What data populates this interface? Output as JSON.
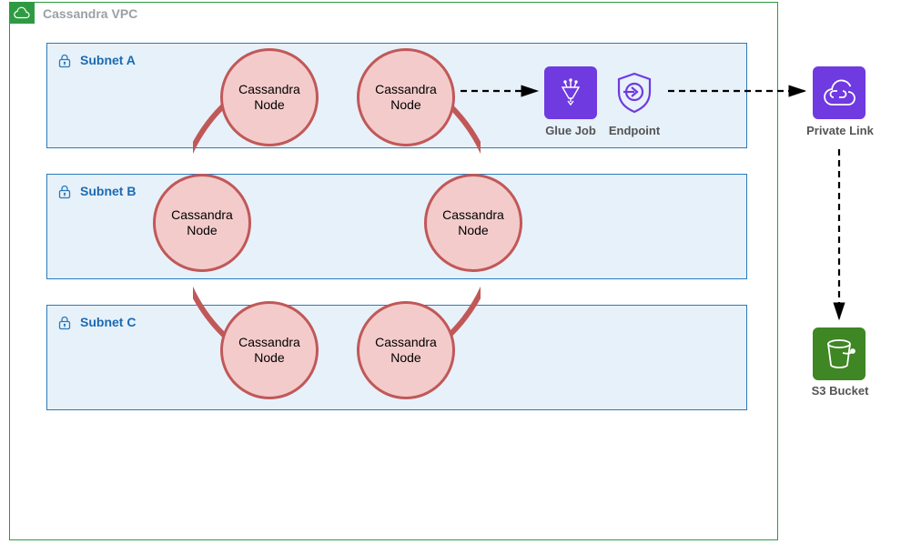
{
  "vpc": {
    "title": "Cassandra VPC",
    "subnets": {
      "a": "Subnet A",
      "b": "Subnet B",
      "c": "Subnet C"
    }
  },
  "nodes": {
    "n1": "Cassandra\nNode",
    "n2": "Cassandra\nNode",
    "n3": "Cassandra\nNode",
    "n4": "Cassandra\nNode",
    "n5": "Cassandra\nNode",
    "n6": "Cassandra\nNode"
  },
  "services": {
    "glue": "Glue Job",
    "endpoint": "Endpoint",
    "privatelink": "Private Link",
    "s3": "S3 Bucket"
  },
  "icons": {
    "vpc_cloud": "vpc-cloud-icon",
    "lock": "lock-icon",
    "glue": "glue-job-icon",
    "endpoint": "endpoint-icon",
    "privatelink": "private-link-icon",
    "s3": "s3-bucket-icon"
  },
  "colors": {
    "vpc_green": "#2e9b42",
    "subnet_blue": "#2a7ab9",
    "subnet_fill": "#e7f1fa",
    "node_fill": "#f4cbcb",
    "node_stroke": "#c15858",
    "purple": "#6f3ae0",
    "s3_green": "#3f8624"
  }
}
